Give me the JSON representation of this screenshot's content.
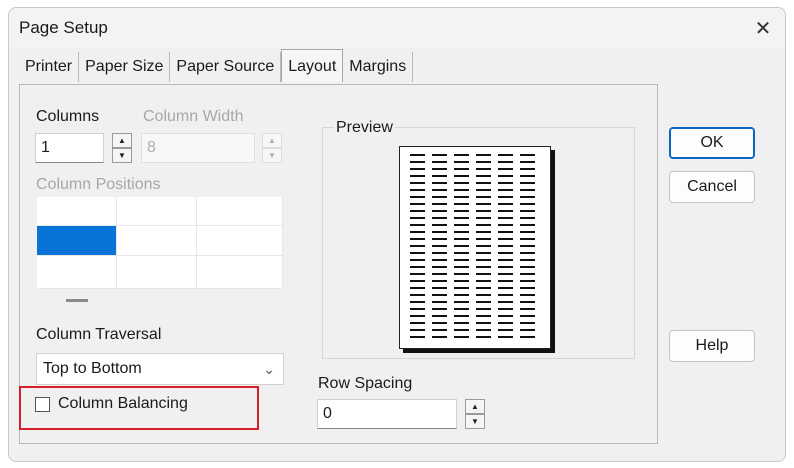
{
  "window": {
    "title": "Page Setup",
    "close_glyph": "✕"
  },
  "tabs": [
    {
      "label": "Printer"
    },
    {
      "label": "Paper Size"
    },
    {
      "label": "Paper Source"
    },
    {
      "label": "Layout",
      "active": true
    },
    {
      "label": "Margins"
    }
  ],
  "layout": {
    "columns_label": "Columns",
    "columns_value": "1",
    "column_width_label": "Column Width",
    "column_width_value": "8",
    "column_positions_label": "Column Positions",
    "column_traversal_label": "Column Traversal",
    "column_traversal_value": "Top to Bottom",
    "column_balancing_label": "Column Balancing",
    "column_balancing_checked": false,
    "row_spacing_label": "Row Spacing",
    "row_spacing_value": "0",
    "preview_label": "Preview"
  },
  "buttons": {
    "ok": "OK",
    "cancel": "Cancel",
    "help": "Help"
  },
  "colors": {
    "accent": "#0a74d6",
    "highlight_box": "#d61f26"
  }
}
